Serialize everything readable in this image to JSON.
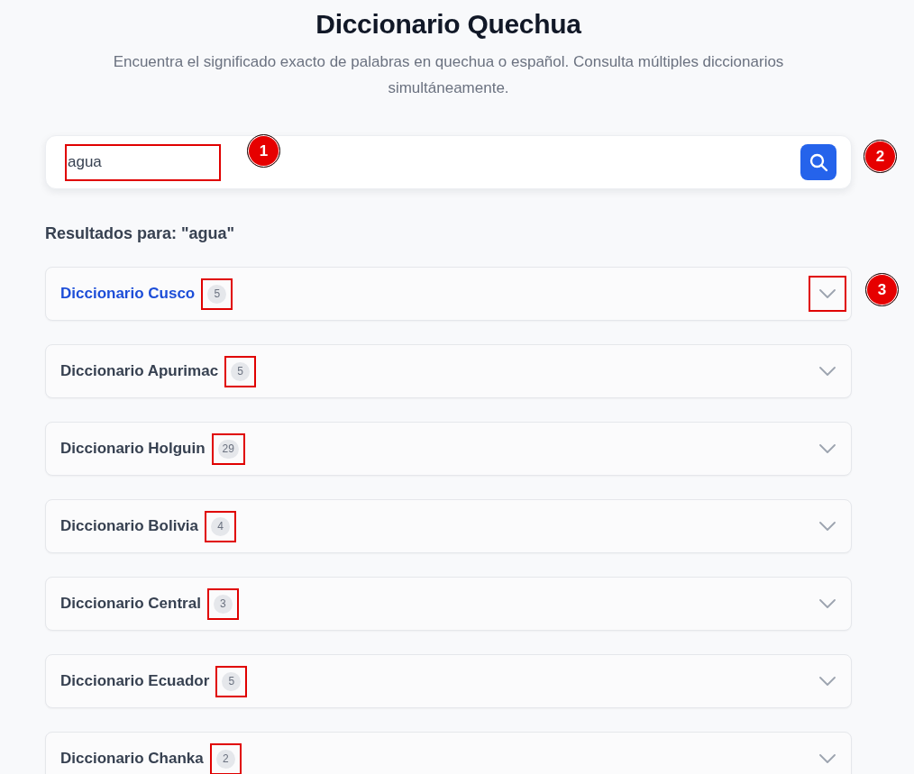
{
  "header": {
    "title": "Diccionario Quechua",
    "subtitle": "Encuentra el significado exacto de palabras en quechua o español. Consulta múltiples diccionarios simultáneamente."
  },
  "search": {
    "value": "agua",
    "outlined": true,
    "marker": "1",
    "button_marker": "2"
  },
  "results_heading": "Resultados para: \"agua\"",
  "dictionaries": [
    {
      "name": "Diccionario Cusco",
      "count": "5",
      "highlighted": true,
      "count_outlined": true,
      "chevron_outlined": true,
      "marker": "3"
    },
    {
      "name": "Diccionario Apurimac",
      "count": "5",
      "highlighted": false,
      "count_outlined": true,
      "chevron_outlined": false
    },
    {
      "name": "Diccionario Holguin",
      "count": "29",
      "highlighted": false,
      "count_outlined": true,
      "chevron_outlined": false
    },
    {
      "name": "Diccionario Bolivia",
      "count": "4",
      "highlighted": false,
      "count_outlined": true,
      "chevron_outlined": false
    },
    {
      "name": "Diccionario Central",
      "count": "3",
      "highlighted": false,
      "count_outlined": true,
      "chevron_outlined": false
    },
    {
      "name": "Diccionario Ecuador",
      "count": "5",
      "highlighted": false,
      "count_outlined": true,
      "chevron_outlined": false
    },
    {
      "name": "Diccionario Chanka",
      "count": "2",
      "highlighted": false,
      "count_outlined": true,
      "chevron_outlined": false
    }
  ]
}
